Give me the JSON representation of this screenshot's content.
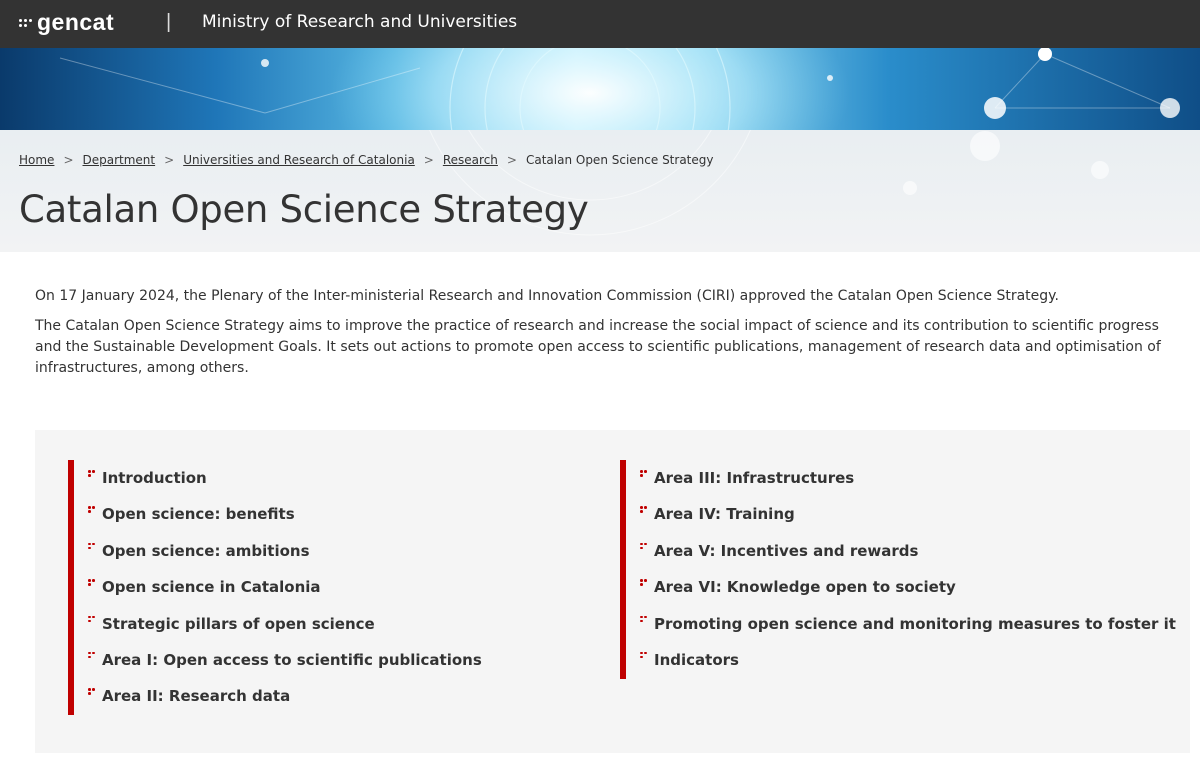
{
  "header": {
    "logo_text": "gencat",
    "divider": "|",
    "ministry": "Ministry of Research and Universities"
  },
  "breadcrumb": {
    "items": [
      "Home",
      "Department",
      "Universities and Research of Catalonia",
      "Research"
    ],
    "current": "Catalan Open Science Strategy",
    "separator": ">"
  },
  "page": {
    "title": "Catalan Open Science Strategy",
    "intro": [
      "On 17 January 2024, the Plenary of the Inter-ministerial Research and Innovation Commission (CIRI) approved the Catalan Open Science Strategy.",
      "The Catalan Open Science Strategy aims to improve the practice of research and increase the social impact of science and its contribution to scientific progress and the Sustainable Development Goals. It sets out actions to promote open access to scientific publications, management of research data and optimisation of infrastructures, among others."
    ]
  },
  "index": {
    "left": [
      "Introduction",
      "Open science: benefits",
      "Open science: ambitions",
      "Open science in Catalonia",
      "Strategic pillars of open science",
      "Area I: Open access to scientific publications",
      "Area II: Research data"
    ],
    "right": [
      "Area III: Infrastructures",
      "Area IV: Training",
      "Area V: Incentives and rewards",
      "Area VI: Knowledge open to society",
      "Promoting open science and monitoring measures to foster it",
      "Indicators"
    ]
  },
  "colors": {
    "topbar": "#333333",
    "accent": "#c00000",
    "index_bg": "#f5f5f5"
  }
}
